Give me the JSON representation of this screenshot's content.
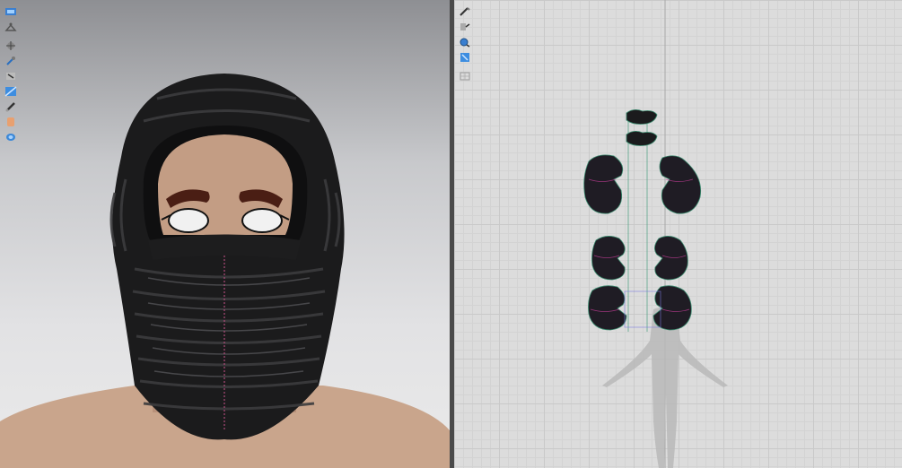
{
  "viewport3d": {
    "tools": [
      "simulation-icon",
      "hanger-icon",
      "transform-icon",
      "pin-icon",
      "select-icon",
      "fabric-icon",
      "brush-icon",
      "avatar-icon",
      "layer-icon"
    ]
  },
  "viewport2d": {
    "tools": [
      "pen-icon",
      "arrange-icon",
      "zoom-icon",
      "sewing-icon",
      "grid-icon"
    ]
  },
  "colors": {
    "garment": "#161616",
    "skin": "#c39d84",
    "pattern_outline": "#3a8a6e",
    "avatar_silhouette": "#b4b4b4"
  }
}
